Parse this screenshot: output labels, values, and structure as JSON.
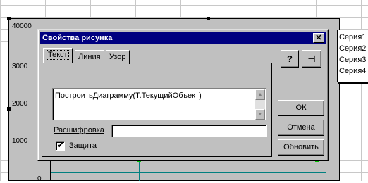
{
  "chart": {
    "y_ticks": [
      "40000",
      "3000",
      "2000",
      "1000",
      "0"
    ],
    "legend": [
      "Серия1",
      "Серия2",
      "Серия3",
      "Серия4"
    ]
  },
  "dialog": {
    "title": "Свойства рисунка",
    "close_glyph": "✕",
    "tabs": [
      "Текст",
      "Линия",
      "Узор"
    ],
    "formula": "ПостроитьДиаграмму(Т.ТекущийОбъект)",
    "decoding_label": "Расшифровка",
    "decoding_value": "",
    "protection_label": "Защита",
    "protection_checked": "✔",
    "help_glyph": "?",
    "pin_glyph": "⊣",
    "buttons": {
      "ok": "ОК",
      "cancel": "Отмена",
      "refresh": "Обновить"
    }
  },
  "colors": {
    "titlebar": "#000080",
    "face": "#c0c0c0",
    "gridline": "#008080",
    "marker": "#00c000"
  }
}
